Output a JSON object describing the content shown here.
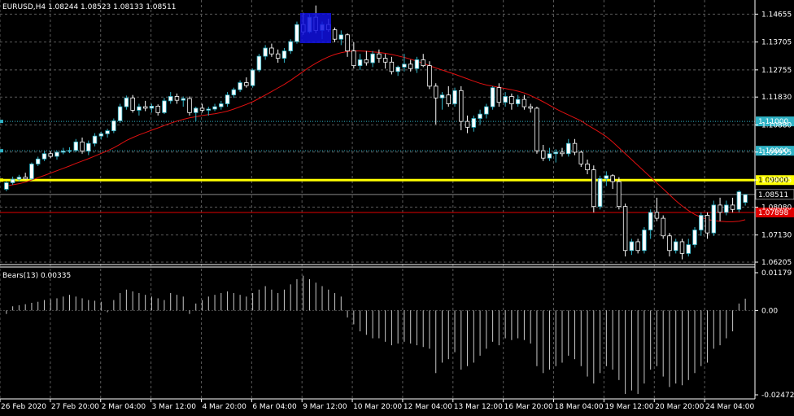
{
  "symbol_header": "EURUSD,H4  1.08244 1.08523 1.08133 1.08511",
  "indicator_header": "Bears(13) 0.00335",
  "price_axis": {
    "ticks": [
      "1.14655",
      "1.13705",
      "1.12755",
      "1.11830",
      "1.10880",
      "1.09955",
      "1.09005",
      "1.08080",
      "1.07130",
      "1.06205"
    ],
    "ylim": [
      1.06205,
      1.1497
    ]
  },
  "indicator_axis": {
    "ticks": [
      "0.01179",
      "0.00",
      "-0.02472"
    ],
    "ylim": [
      -0.02472,
      0.01179
    ]
  },
  "x_axis": {
    "labels": [
      "26 Feb 2020",
      "27 Feb 20:00",
      "2 Mar 04:00",
      "3 Mar 12:00",
      "4 Mar 20:00",
      "6 Mar 04:00",
      "9 Mar 12:00",
      "10 Mar 20:00",
      "12 Mar 04:00",
      "13 Mar 12:00",
      "16 Mar 20:00",
      "18 Mar 04:00",
      "19 Mar 12:00",
      "20 Mar 20:00",
      "24 Mar 04:00"
    ]
  },
  "horizontal_lines": [
    {
      "price": 1.11,
      "label": "1.11000",
      "color": "#2fb3c6",
      "style": "dotted"
    },
    {
      "price": 1.1,
      "label": "1.10000",
      "color": "#2fb3c6",
      "style": "dotted"
    },
    {
      "price": 1.09,
      "label": "1.09000",
      "color": "#ffff00",
      "style": "solid-thick"
    },
    {
      "price": 1.08511,
      "label": "1.08511",
      "color": "#8a8a8a",
      "style": "bid"
    },
    {
      "price": 1.07898,
      "label": "1.07898",
      "color": "#e00000",
      "style": "solid"
    }
  ],
  "colors": {
    "bull_candle": "#ffffff",
    "bear_candle": "#000000",
    "wick_bull": "#2fb3c6",
    "wick_bear": "#ffffff",
    "moving_average": "#e01010",
    "grid": "#5a5a5a",
    "histogram": "#c8c8c8",
    "highlight_box": "#1010e0"
  },
  "chart_data": {
    "type": "candlestick",
    "timeframe": "H4",
    "symbol": "EURUSD",
    "candles": [
      [
        1.0869,
        1.0896,
        1.0862,
        1.0891
      ],
      [
        1.0891,
        1.0912,
        1.0884,
        1.0903
      ],
      [
        1.0903,
        1.0918,
        1.0895,
        1.091
      ],
      [
        1.091,
        1.0925,
        1.0902,
        1.0904
      ],
      [
        1.0904,
        1.096,
        1.09,
        1.0955
      ],
      [
        1.0955,
        1.098,
        1.0948,
        1.0972
      ],
      [
        1.0972,
        1.0998,
        1.0965,
        1.099
      ],
      [
        1.099,
        1.0999,
        1.0975,
        1.0981
      ],
      [
        1.0981,
        1.1,
        1.097,
        1.0995
      ],
      [
        1.0995,
        1.101,
        1.0988,
        1.0999
      ],
      [
        1.0999,
        1.1012,
        1.0992,
        1.1001
      ],
      [
        1.1001,
        1.104,
        1.0995,
        1.103
      ],
      [
        1.103,
        1.1045,
        1.099,
        1.0999
      ],
      [
        1.0999,
        1.1035,
        1.0985,
        1.1025
      ],
      [
        1.1025,
        1.106,
        1.1015,
        1.105
      ],
      [
        1.105,
        1.1065,
        1.1038,
        1.1058
      ],
      [
        1.1058,
        1.1075,
        1.1045,
        1.1068
      ],
      [
        1.1068,
        1.111,
        1.106,
        1.1102
      ],
      [
        1.1102,
        1.116,
        1.1095,
        1.115
      ],
      [
        1.115,
        1.1188,
        1.114,
        1.118
      ],
      [
        1.118,
        1.119,
        1.113,
        1.1138
      ],
      [
        1.1138,
        1.116,
        1.112,
        1.115
      ],
      [
        1.115,
        1.117,
        1.1135,
        1.1145
      ],
      [
        1.1145,
        1.116,
        1.113,
        1.1152
      ],
      [
        1.1152,
        1.1158,
        1.112,
        1.113
      ],
      [
        1.113,
        1.118,
        1.1125,
        1.117
      ],
      [
        1.117,
        1.12,
        1.116,
        1.1185
      ],
      [
        1.1185,
        1.1195,
        1.116,
        1.1172
      ],
      [
        1.1172,
        1.1185,
        1.115,
        1.1178
      ],
      [
        1.1178,
        1.1185,
        1.112,
        1.113
      ],
      [
        1.113,
        1.115,
        1.11,
        1.1145
      ],
      [
        1.1145,
        1.116,
        1.113,
        1.1138
      ],
      [
        1.1138,
        1.115,
        1.112,
        1.1142
      ],
      [
        1.1142,
        1.116,
        1.1135,
        1.115
      ],
      [
        1.115,
        1.117,
        1.114,
        1.116
      ],
      [
        1.116,
        1.12,
        1.115,
        1.119
      ],
      [
        1.119,
        1.1215,
        1.118,
        1.1208
      ],
      [
        1.1208,
        1.124,
        1.12,
        1.1232
      ],
      [
        1.1232,
        1.125,
        1.1215,
        1.1222
      ],
      [
        1.1222,
        1.128,
        1.1215,
        1.1275
      ],
      [
        1.1275,
        1.133,
        1.1268,
        1.1322
      ],
      [
        1.1322,
        1.136,
        1.131,
        1.135
      ],
      [
        1.135,
        1.1365,
        1.132,
        1.133
      ],
      [
        1.133,
        1.1345,
        1.13,
        1.1315
      ],
      [
        1.1315,
        1.135,
        1.13,
        1.134
      ],
      [
        1.134,
        1.138,
        1.133,
        1.1372
      ],
      [
        1.1372,
        1.144,
        1.1365,
        1.143
      ],
      [
        1.143,
        1.147,
        1.1395,
        1.1405
      ],
      [
        1.1405,
        1.1465,
        1.14,
        1.1455
      ],
      [
        1.1455,
        1.1495,
        1.14,
        1.141
      ],
      [
        1.141,
        1.144,
        1.138,
        1.143
      ],
      [
        1.143,
        1.145,
        1.1405,
        1.1412
      ],
      [
        1.1412,
        1.142,
        1.137,
        1.138
      ],
      [
        1.138,
        1.141,
        1.136,
        1.1395
      ],
      [
        1.1395,
        1.14,
        1.132,
        1.134
      ],
      [
        1.134,
        1.137,
        1.128,
        1.129
      ],
      [
        1.129,
        1.133,
        1.1275,
        1.131
      ],
      [
        1.131,
        1.134,
        1.129,
        1.13
      ],
      [
        1.13,
        1.134,
        1.1285,
        1.133
      ],
      [
        1.133,
        1.1345,
        1.13,
        1.1315
      ],
      [
        1.1315,
        1.133,
        1.128,
        1.1302
      ],
      [
        1.1302,
        1.132,
        1.126,
        1.127
      ],
      [
        1.127,
        1.129,
        1.1255,
        1.1285
      ],
      [
        1.1285,
        1.133,
        1.127,
        1.1295
      ],
      [
        1.1295,
        1.131,
        1.127,
        1.128
      ],
      [
        1.128,
        1.132,
        1.1265,
        1.131
      ],
      [
        1.131,
        1.133,
        1.1285,
        1.129
      ],
      [
        1.129,
        1.1305,
        1.121,
        1.122
      ],
      [
        1.122,
        1.123,
        1.109,
        1.118
      ],
      [
        1.118,
        1.12,
        1.114,
        1.119
      ],
      [
        1.119,
        1.122,
        1.115,
        1.116
      ],
      [
        1.116,
        1.1215,
        1.115,
        1.1205
      ],
      [
        1.1205,
        1.122,
        1.107,
        1.11
      ],
      [
        1.11,
        1.112,
        1.106,
        1.108
      ],
      [
        1.108,
        1.112,
        1.1065,
        1.111
      ],
      [
        1.111,
        1.114,
        1.109,
        1.1125
      ],
      [
        1.1125,
        1.116,
        1.111,
        1.115
      ],
      [
        1.115,
        1.122,
        1.114,
        1.1215
      ],
      [
        1.1215,
        1.123,
        1.115,
        1.1165
      ],
      [
        1.1165,
        1.12,
        1.115,
        1.1185
      ],
      [
        1.1185,
        1.1195,
        1.114,
        1.116
      ],
      [
        1.116,
        1.119,
        1.115,
        1.1175
      ],
      [
        1.1175,
        1.119,
        1.114,
        1.115
      ],
      [
        1.115,
        1.116,
        1.113,
        1.1145
      ],
      [
        1.1145,
        1.115,
        1.099,
        1.1
      ],
      [
        1.1,
        1.102,
        1.0965,
        1.0975
      ],
      [
        1.0975,
        1.101,
        1.0965,
        1.099
      ],
      [
        1.099,
        1.1005,
        1.096,
        1.0995
      ],
      [
        1.0995,
        1.101,
        1.098,
        1.099
      ],
      [
        1.099,
        1.104,
        1.098,
        1.1025
      ],
      [
        1.1025,
        1.104,
        1.0985,
        1.0995
      ],
      [
        1.0995,
        1.1,
        1.0945,
        1.0955
      ],
      [
        1.0955,
        1.097,
        1.092,
        1.0935
      ],
      [
        1.0935,
        1.095,
        1.079,
        1.081
      ],
      [
        1.081,
        1.0915,
        1.08,
        1.0905
      ],
      [
        1.0905,
        1.093,
        1.088,
        1.0915
      ],
      [
        1.0915,
        1.092,
        1.087,
        1.0895
      ],
      [
        1.0895,
        1.091,
        1.08,
        1.081
      ],
      [
        1.081,
        1.082,
        1.064,
        1.066
      ],
      [
        1.066,
        1.07,
        1.0645,
        1.069
      ],
      [
        1.069,
        1.07,
        1.065,
        1.066
      ],
      [
        1.066,
        1.074,
        1.065,
        1.073
      ],
      [
        1.073,
        1.08,
        1.07,
        1.079
      ],
      [
        1.079,
        1.084,
        1.076,
        1.077
      ],
      [
        1.077,
        1.078,
        1.07,
        1.071
      ],
      [
        1.071,
        1.072,
        1.064,
        1.066
      ],
      [
        1.066,
        1.07,
        1.065,
        1.069
      ],
      [
        1.069,
        1.07,
        1.063,
        1.065
      ],
      [
        1.065,
        1.07,
        1.064,
        1.068
      ],
      [
        1.068,
        1.074,
        1.067,
        1.073
      ],
      [
        1.073,
        1.079,
        1.071,
        1.078
      ],
      [
        1.078,
        1.079,
        1.07,
        1.072
      ],
      [
        1.072,
        1.083,
        1.071,
        1.0815
      ],
      [
        1.0815,
        1.084,
        1.076,
        1.079
      ],
      [
        1.079,
        1.083,
        1.078,
        1.0815
      ],
      [
        1.0815,
        1.084,
        1.079,
        1.08
      ],
      [
        1.08,
        1.0865,
        1.079,
        1.086
      ],
      [
        1.0824,
        1.0852,
        1.0813,
        1.0851
      ]
    ],
    "moving_average": [
      1.088,
      1.0884,
      1.0888,
      1.0893,
      1.09,
      1.0908,
      1.0916,
      1.0924,
      1.0932,
      1.094,
      1.0948,
      1.0957,
      1.0965,
      1.0973,
      1.0982,
      1.0991,
      1.1,
      1.101,
      1.1022,
      1.1035,
      1.1045,
      1.1054,
      1.1062,
      1.107,
      1.1078,
      1.1086,
      1.1094,
      1.1101,
      1.1107,
      1.1112,
      1.1116,
      1.112,
      1.1123,
      1.1126,
      1.113,
      1.1135,
      1.1142,
      1.115,
      1.1158,
      1.1167,
      1.1178,
      1.119,
      1.1202,
      1.1214,
      1.1226,
      1.124,
      1.1255,
      1.127,
      1.1285,
      1.1298,
      1.131,
      1.132,
      1.1328,
      1.1334,
      1.1338,
      1.134,
      1.134,
      1.1339,
      1.1337,
      1.1335,
      1.1332,
      1.1328,
      1.1323,
      1.1318,
      1.1312,
      1.1305,
      1.1298,
      1.129,
      1.1282,
      1.1275,
      1.1268,
      1.1261,
      1.1253,
      1.1245,
      1.1237,
      1.123,
      1.1224,
      1.122,
      1.1216,
      1.1212,
      1.1208,
      1.1203,
      1.1197,
      1.1188,
      1.1178,
      1.1167,
      1.1155,
      1.1143,
      1.1132,
      1.1122,
      1.1112,
      1.1102,
      1.1088,
      1.1075,
      1.1062,
      1.1048,
      1.103,
      1.101,
      1.099,
      1.097,
      1.095,
      1.093,
      1.091,
      1.089,
      1.087,
      1.085,
      1.083,
      1.0812,
      1.0796,
      1.0783,
      1.0773,
      1.0766,
      1.0762,
      1.076,
      1.0758,
      1.0758,
      1.076,
      1.0765
    ],
    "bears": [
      -0.001,
      0.0012,
      0.0015,
      0.0018,
      0.0022,
      0.0025,
      0.003,
      0.0032,
      0.0035,
      0.004,
      0.0045,
      0.004,
      0.0035,
      0.003,
      0.0028,
      0.0025,
      -0.0005,
      0.003,
      0.005,
      0.006,
      0.0055,
      0.005,
      0.0045,
      0.004,
      0.0035,
      0.003,
      0.005,
      0.0045,
      0.004,
      -0.001,
      0.002,
      0.003,
      0.004,
      0.0045,
      0.005,
      0.0055,
      0.005,
      0.0045,
      0.004,
      0.005,
      0.006,
      0.007,
      0.006,
      0.005,
      0.006,
      0.0075,
      0.009,
      0.01,
      0.009,
      0.008,
      0.007,
      0.006,
      0.005,
      0.004,
      -0.002,
      -0.004,
      -0.006,
      -0.007,
      -0.008,
      -0.008,
      -0.009,
      -0.01,
      -0.0095,
      -0.009,
      -0.0095,
      -0.01,
      -0.0105,
      -0.011,
      -0.018,
      -0.015,
      -0.014,
      -0.012,
      -0.017,
      -0.016,
      -0.015,
      -0.013,
      -0.011,
      -0.009,
      -0.01,
      -0.008,
      -0.0085,
      -0.008,
      -0.0085,
      -0.0095,
      -0.016,
      -0.018,
      -0.017,
      -0.016,
      -0.015,
      -0.013,
      -0.014,
      -0.016,
      -0.019,
      -0.021,
      -0.018,
      -0.016,
      -0.017,
      -0.02,
      -0.024,
      -0.023,
      -0.024,
      -0.021,
      -0.017,
      -0.016,
      -0.019,
      -0.022,
      -0.021,
      -0.0215,
      -0.02,
      -0.018,
      -0.016,
      -0.015,
      -0.011,
      -0.01,
      -0.008,
      -0.006,
      0.002,
      0.0034
    ]
  }
}
